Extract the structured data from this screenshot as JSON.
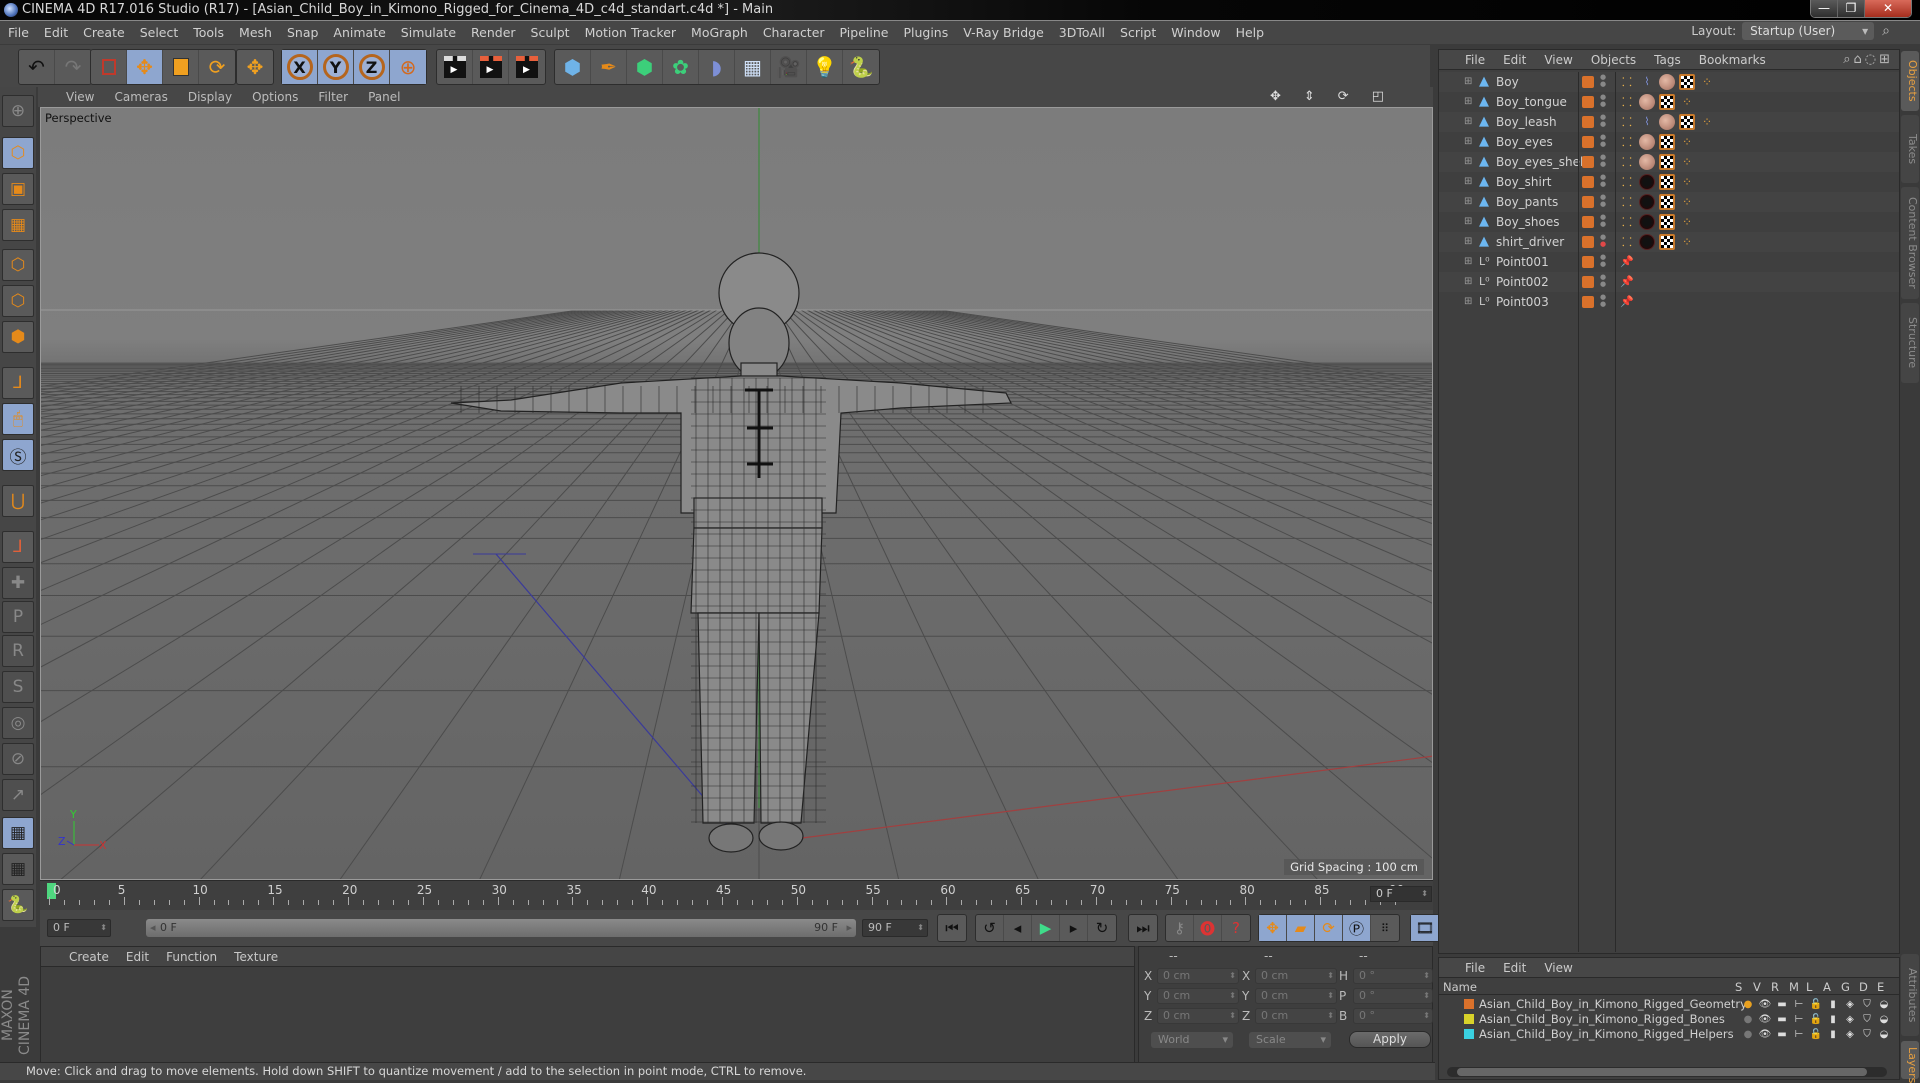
{
  "window": {
    "title": "CINEMA 4D R17.016 Studio (R17) - [Asian_Child_Boy_in_Kimono_Rigged_for_Cinema_4D_c4d_standart.c4d *] - Main",
    "controls": {
      "minimize": "—",
      "maximize": "❐",
      "close": "✕"
    }
  },
  "menubar": {
    "items": [
      "File",
      "Edit",
      "Create",
      "Select",
      "Tools",
      "Mesh",
      "Snap",
      "Animate",
      "Simulate",
      "Render",
      "Sculpt",
      "Motion Tracker",
      "MoGraph",
      "Character",
      "Pipeline",
      "Plugins",
      "V-Ray Bridge",
      "3DToAll",
      "Script",
      "Window",
      "Help"
    ],
    "layout_label": "Layout:",
    "layout_value": "Startup (User)"
  },
  "toolbar": {
    "groups": [
      [
        "undo-icon",
        "redo-icon"
      ],
      [
        "live-selection-icon",
        "move-icon",
        "scale-icon",
        "rotate-icon"
      ],
      [
        "last-tool-icon"
      ],
      [
        "x-axis-icon",
        "y-axis-icon",
        "z-axis-icon",
        "world-coordinates-icon"
      ],
      [
        "render-view-icon",
        "render-picture-viewer-icon",
        "render-settings-icon"
      ],
      [
        "cube-icon",
        "pen-spline-icon",
        "subdivision-surface-icon",
        "cloner-icon",
        "deformer-icon",
        "floor-icon",
        "camera-icon",
        "light-icon",
        "python-icon"
      ]
    ],
    "axis_labels": {
      "x": "X",
      "y": "Y",
      "z": "Z"
    }
  },
  "left_tools": [
    "viewport-solo-icon",
    "model-mode-icon",
    "texture-mode-icon",
    "workplane-mode-icon",
    "points-mode-icon",
    "edges-mode-icon",
    "polygons-mode-icon",
    "axis-mode-icon",
    "tweak-mode-icon",
    "snap-icon",
    "magnet-icon",
    "locked-workplane-icon",
    "joint-tool-icon",
    "ik-p-icon",
    "ik-r-icon",
    "ik-psr-icon",
    "ik-target-icon",
    "ik-pole-icon",
    "ik-goal-icon",
    "grid-lock-icon",
    "grid-rotate-icon",
    "python-icon"
  ],
  "viewport": {
    "menu": [
      "View",
      "Cameras",
      "Display",
      "Options",
      "Filter",
      "Panel"
    ],
    "camera_label": "Perspective",
    "grid_spacing": "Grid Spacing : 100 cm",
    "axis_gizmo": {
      "x": "X",
      "y": "Y",
      "z": "Z"
    },
    "nav_icons": [
      "pan-icon",
      "dolly-icon",
      "orbit-icon",
      "maximize-view-icon"
    ]
  },
  "timeline": {
    "start": 0,
    "end": 90,
    "major_step": 5,
    "current_frame": "0 F",
    "playhead": 0
  },
  "transport": {
    "start_field": "0 F",
    "range_start": "0 F",
    "range_end": "90 F",
    "end_field": "90 F",
    "buttons": [
      "go-to-start-icon",
      "previous-key-icon",
      "previous-frame-icon",
      "play-icon",
      "next-frame-icon",
      "next-key-icon",
      "go-to-end-icon"
    ],
    "record_buttons": [
      "record-keys-icon",
      "auto-keying-icon",
      "keyframe-selection-icon"
    ],
    "key_buttons": [
      "position-key-icon",
      "scale-key-icon",
      "rotation-key-icon",
      "parameter-key-icon",
      "point-level-icon",
      "timeline-icon"
    ]
  },
  "material_manager": {
    "menu": [
      "Create",
      "Edit",
      "Function",
      "Texture"
    ]
  },
  "coordinates": {
    "headers": [
      "--",
      "--",
      "--"
    ],
    "rows": [
      {
        "l1": "X",
        "v1": "0 cm",
        "l2": "X",
        "v2": "0 cm",
        "l3": "H",
        "v3": "0 °"
      },
      {
        "l1": "Y",
        "v1": "0 cm",
        "l2": "Y",
        "v2": "0 cm",
        "l3": "P",
        "v3": "0 °"
      },
      {
        "l1": "Z",
        "v1": "0 cm",
        "l2": "Z",
        "v2": "0 cm",
        "l3": "B",
        "v3": "0 °"
      }
    ],
    "mode": "World",
    "size_mode": "Scale",
    "apply": "Apply"
  },
  "objects": {
    "menu": [
      "File",
      "Edit",
      "View",
      "Objects",
      "Tags",
      "Bookmarks"
    ],
    "items": [
      {
        "name": "Boy",
        "type": "polygon",
        "tags": [
          "phong",
          "ik",
          "mat",
          "uv",
          "wt"
        ]
      },
      {
        "name": "Boy_tongue",
        "type": "polygon",
        "tags": [
          "phong",
          "mat",
          "uv",
          "wt"
        ]
      },
      {
        "name": "Boy_leash",
        "type": "polygon",
        "tags": [
          "phong",
          "ik",
          "mat",
          "uv",
          "wt"
        ]
      },
      {
        "name": "Boy_eyes",
        "type": "polygon",
        "tags": [
          "phong",
          "mat",
          "uv",
          "wt"
        ]
      },
      {
        "name": "Boy_eyes_shell",
        "type": "polygon",
        "tags": [
          "phong",
          "mat",
          "uv",
          "wt"
        ]
      },
      {
        "name": "Boy_shirt",
        "type": "polygon",
        "tags": [
          "phong",
          "matd",
          "uv",
          "wt"
        ]
      },
      {
        "name": "Boy_pants",
        "type": "polygon",
        "tags": [
          "phong",
          "matd",
          "uv",
          "wt"
        ]
      },
      {
        "name": "Boy_shoes",
        "type": "polygon",
        "tags": [
          "phong",
          "matd",
          "uv",
          "wt"
        ]
      },
      {
        "name": "shirt_driver",
        "type": "polygon",
        "tags": [
          "phong",
          "matd",
          "uv",
          "wt"
        ],
        "render_off": true
      },
      {
        "name": "Point001",
        "type": "null",
        "tags": [
          "pin"
        ]
      },
      {
        "name": "Point002",
        "type": "null",
        "tags": [
          "pin"
        ]
      },
      {
        "name": "Point003",
        "type": "null",
        "tags": [
          "pin"
        ]
      }
    ],
    "layer_color": "#d9712b"
  },
  "side_tabs_top": [
    "Objects",
    "Takes",
    "Content Browser",
    "Structure"
  ],
  "side_tabs_bottom": [
    "Attributes",
    "Layers"
  ],
  "layers": {
    "menu": [
      "File",
      "Edit",
      "View"
    ],
    "columns": [
      "Name",
      "S",
      "V",
      "R",
      "M",
      "L",
      "A",
      "G",
      "D",
      "E"
    ],
    "items": [
      {
        "name": "Asian_Child_Boy_in_Kimono_Rigged_Geometry",
        "color": "#d9712b",
        "solo": true
      },
      {
        "name": "Asian_Child_Boy_in_Kimono_Rigged_Bones",
        "color": "#d8d22a",
        "solo": false
      },
      {
        "name": "Asian_Child_Boy_in_Kimono_Rigged_Helpers",
        "color": "#3ad0e0",
        "solo": false
      }
    ]
  },
  "status": "Move: Click and drag to move elements. Hold down SHIFT to quantize movement / add to the selection in point mode, CTRL to remove.",
  "branding": "MAXON CINEMA 4D",
  "colors": {
    "accent": "#8ea6cf",
    "orange": "#e58a1a",
    "playhead": "#4fd77f",
    "active_tab": "#e8a040"
  }
}
